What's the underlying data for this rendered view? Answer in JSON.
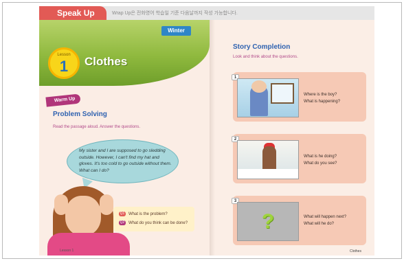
{
  "topbar": {
    "tab_label": "Speak Up",
    "note": "Wrap Up은 전화영어 학습일 기준 다음날까지 작성 가능합니다."
  },
  "left": {
    "season_badge": "Winter",
    "lesson_word": "Lesson",
    "lesson_number": "1",
    "lesson_title": "Clothes",
    "warmup_label": "Warm Up",
    "section_title": "Problem Solving",
    "instruction": "Read the passage aloud. Answer the questions.",
    "passage": "My sister and I are supposed to go sledding outside. However, I can't find my hat and gloves. It's too cold to go outside without them. What can I do?",
    "questions": [
      {
        "badge": "Q1",
        "text": "What is the problem?"
      },
      {
        "badge": "Q2",
        "text": "What do you think can be done?"
      }
    ],
    "footer": "Lesson 1"
  },
  "right": {
    "section_title": "Story Completion",
    "instruction": "Look and think about the questions.",
    "cards": [
      {
        "number": "1",
        "q1": "Where is the boy?",
        "q2": "What is happening?"
      },
      {
        "number": "2",
        "q1": "What is he doing?",
        "q2": "What do you see?"
      },
      {
        "number": "3",
        "q1": "What will happen next?",
        "q2": "What will he do?",
        "placeholder": "?"
      }
    ],
    "footer": "Clothes"
  }
}
